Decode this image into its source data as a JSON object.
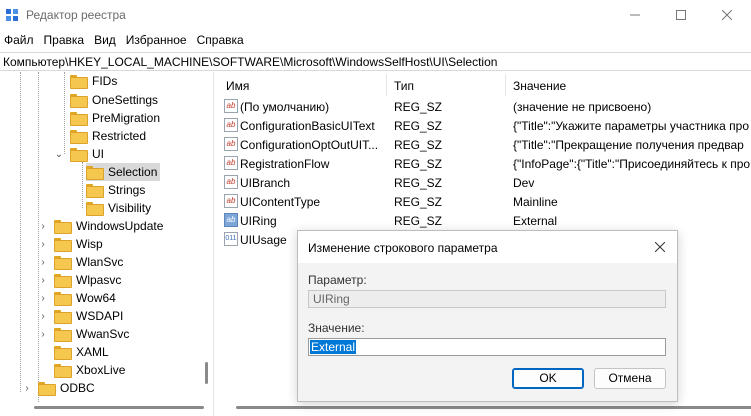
{
  "window": {
    "title": "Редактор реестра"
  },
  "menu": [
    "Файл",
    "Правка",
    "Вид",
    "Избранное",
    "Справка"
  ],
  "address": "Компьютер\\HKEY_LOCAL_MACHINE\\SOFTWARE\\Microsoft\\WindowsSelfHost\\UI\\Selection",
  "tree": [
    {
      "label": "FIDs"
    },
    {
      "label": "OneSettings"
    },
    {
      "label": "PreMigration"
    },
    {
      "label": "Restricted"
    },
    {
      "label": "UI"
    },
    {
      "label": "Selection"
    },
    {
      "label": "Strings"
    },
    {
      "label": "Visibility"
    },
    {
      "label": "WindowsUpdate"
    },
    {
      "label": "Wisp"
    },
    {
      "label": "WlanSvc"
    },
    {
      "label": "Wlpasvc"
    },
    {
      "label": "Wow64"
    },
    {
      "label": "WSDAPI"
    },
    {
      "label": "WwanSvc"
    },
    {
      "label": "XAML"
    },
    {
      "label": "XboxLive"
    },
    {
      "label": "ODBC"
    }
  ],
  "list": {
    "columns": [
      "Имя",
      "Тип",
      "Значение"
    ],
    "rows": [
      {
        "name": "(По умолчанию)",
        "type": "REG_SZ",
        "value": "(значение не присвоено)"
      },
      {
        "name": "ConfigurationBasicUIText",
        "type": "REG_SZ",
        "value": "{\"Title\":\"Укажите параметры участника про"
      },
      {
        "name": "ConfigurationOptOutUIT...",
        "type": "REG_SZ",
        "value": "{\"Title\":\"Прекращение получения предвар"
      },
      {
        "name": "RegistrationFlow",
        "type": "REG_SZ",
        "value": "{\"InfoPage\":{\"Title\":\"Присоединяйтесь к про"
      },
      {
        "name": "UIBranch",
        "type": "REG_SZ",
        "value": "Dev"
      },
      {
        "name": "UIContentType",
        "type": "REG_SZ",
        "value": "Mainline"
      },
      {
        "name": "UIRing",
        "type": "REG_SZ",
        "value": "External"
      },
      {
        "name": "UIUsage",
        "type": "",
        "value": ""
      }
    ]
  },
  "dialog": {
    "title": "Изменение строкового параметра",
    "param_label": "Параметр:",
    "param_value": "UIRing",
    "value_label": "Значение:",
    "value_value": "External",
    "ok": "OK",
    "cancel": "Отмена"
  },
  "icons": {
    "app": "registry-editor-icon",
    "string_value": "ab-string-icon",
    "binary_value": "binary-value-icon",
    "folder": "folder-icon"
  }
}
